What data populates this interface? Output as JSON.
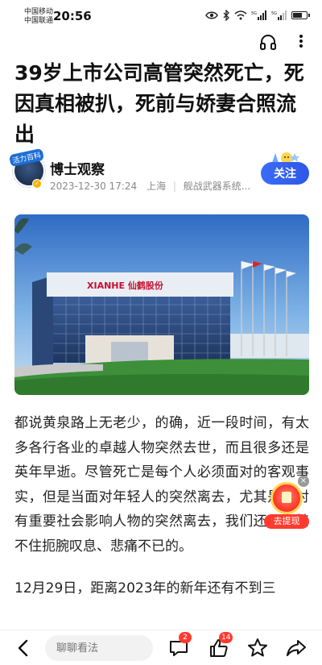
{
  "status_bar": {
    "carrier_1": "中国移动",
    "carrier_2": "中国联通",
    "time": "20:56",
    "icons": [
      "eye-icon",
      "bluetooth-icon",
      "wifi-icon",
      "signal-5g-icon",
      "signal-5g-icon",
      "battery-icon"
    ]
  },
  "toolbar": {
    "icons": [
      "headphone-icon",
      "more-icon"
    ]
  },
  "article": {
    "title": "39岁上市公司高管突然死亡，死因真相被扒，死前与娇妻合照流出",
    "author": {
      "name": "博士观察",
      "avatar_tag": "活力百科",
      "date": "2023-12-30 17:24",
      "location": "上海",
      "category": "舰战武器系统..."
    },
    "follow_label": "关注",
    "hero_image": {
      "building_sign": "XIANHE 仙鹤股份"
    },
    "paragraphs": [
      "都说黄泉路上无老少，的确，近一段时间，有太多各行各业的卓越人物突然去世，而且很多还是英年早逝。尽管死亡是每个人必须面对的客观事实，但是当面对年轻人的突然离去，尤其是面对有重要社会影响人物的突然离去，我们还是会禁不住扼腕叹息、悲痛不已的。",
      "12月29日，距离2023年的新年还有不到三"
    ]
  },
  "reward_widget": {
    "label": "去提现",
    "close": "×"
  },
  "bottom_bar": {
    "comment_placeholder": "聊聊看法",
    "comment_count": "2",
    "like_count": "14"
  },
  "colors": {
    "accent": "#2f57e8",
    "badge_red": "#ff3b30"
  }
}
